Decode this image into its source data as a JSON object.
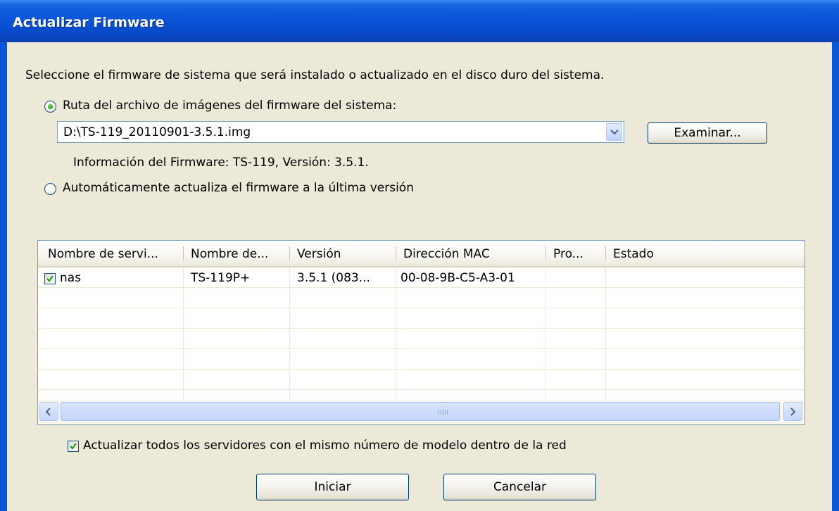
{
  "window": {
    "title": "Actualizar Firmware"
  },
  "intro": "Seleccione el firmware de sistema que será instalado o actualizado en el disco duro del sistema.",
  "option_path": {
    "label": "Ruta del archivo de imágenes del firmware del sistema:",
    "selected": true
  },
  "path_combo": {
    "value": "D:\\TS-119_20110901-3.5.1.img"
  },
  "browse_button": "Examinar...",
  "firmware_info": "Información del Firmware: TS-119, Versión: 3.5.1.",
  "option_auto": {
    "label": "Automáticamente  actualiza el firmware a la última versión",
    "selected": false
  },
  "server_table": {
    "columns": [
      "Nombre de servi...",
      "Nombre de...",
      "Versión",
      "Dirección MAC",
      "Pro...",
      "Estado"
    ],
    "rows": [
      {
        "checked": true,
        "server": "nas",
        "model": "TS-119P+",
        "version": "3.5.1 (083...",
        "mac": "00-08-9B-C5-A3-01",
        "pro": "",
        "status": ""
      }
    ]
  },
  "update_all_checkbox": {
    "label": "Actualizar todos los servidores con el mismo número de modelo dentro de la red",
    "checked": true
  },
  "start_button": "Iniciar",
  "cancel_button": "Cancelar"
}
